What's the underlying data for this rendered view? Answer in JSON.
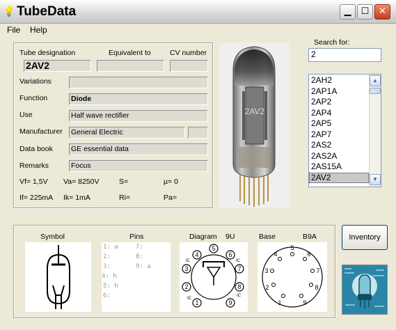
{
  "window": {
    "title": "TubeData",
    "icon": "bulb-icon",
    "minimize": "minimize-icon",
    "maximize": "maximize-icon",
    "close": "close-icon"
  },
  "menu": [
    "File",
    "Help"
  ],
  "form": {
    "labels": {
      "designation": "Tube designation",
      "equivalent": "Equivalent to",
      "cv": "CV number",
      "variations": "Variations",
      "function": "Function",
      "use": "Use",
      "manufacturer": "Manufacturer",
      "databook": "Data book",
      "remarks": "Remarks"
    },
    "values": {
      "designation": "2AV2",
      "equivalent": "",
      "cv": "",
      "variations": "",
      "function": "Diode",
      "use": "Half wave rectifier",
      "manufacturer": "General Electric",
      "manufacturer_extra": "",
      "databook": "GE essential data",
      "remarks": "Focus"
    },
    "params_row1": [
      "Vf= 1,5V",
      "Va=  8250V",
      "S=",
      "µ=    0"
    ],
    "params_row2": [
      "If= 225mA",
      "Ik=   1mA",
      "Ri=",
      "Pa="
    ]
  },
  "photo": {
    "tube_label": "2AV2"
  },
  "search": {
    "label": "Search for:",
    "value": "2",
    "items": [
      "2AH2",
      "2AP1A",
      "2AP2",
      "2AP4",
      "2AP5",
      "2AP7",
      "2AS2",
      "2AS2A",
      "2AS15A",
      "2AV2"
    ],
    "selected": "2AV2"
  },
  "bottom": {
    "symbol_label": "Symbol",
    "pins_label": "Pins",
    "diagram_label": "Diagram",
    "diagram_code": "9U",
    "base_label": "Base",
    "base_code": "B9A",
    "pins_col1": [
      "1: a",
      "2:",
      "3:",
      "4: h",
      "5: h",
      "6:"
    ],
    "pins_col2": [
      "7:",
      "8:",
      "9: a"
    ],
    "diagram_pins": [
      "1",
      "2",
      "3",
      "4",
      "5",
      "6",
      "7",
      "8",
      "9"
    ],
    "diagram_ic": [
      "IC",
      "IC",
      "IC",
      "IC"
    ],
    "base_pins": [
      "1",
      "2",
      "3",
      "4",
      "5",
      "6",
      "7",
      "8",
      "9"
    ],
    "inventory_button": "Inventory"
  }
}
